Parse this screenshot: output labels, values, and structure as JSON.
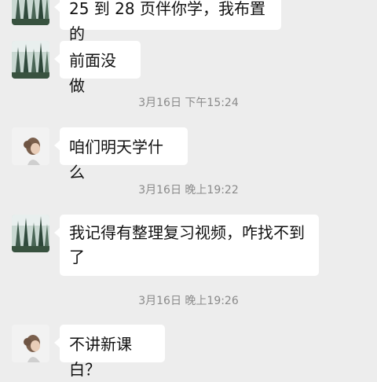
{
  "messages": [
    {
      "kind": "message",
      "avatar": "forest-avatar",
      "text": "25 到 28 页伴你学，我布置的"
    },
    {
      "kind": "message",
      "avatar": "forest-avatar",
      "text": "前面没做"
    },
    {
      "kind": "timestamp",
      "text": "3月16日 下午15:24"
    },
    {
      "kind": "message",
      "avatar": "girl-avatar",
      "text": "咱们明天学什么"
    },
    {
      "kind": "timestamp",
      "text": "3月16日 晚上19:22"
    },
    {
      "kind": "message",
      "avatar": "forest-avatar",
      "text": "我记得有整理复习视频，咋找不到了"
    },
    {
      "kind": "timestamp",
      "text": "3月16日 晚上19:26"
    },
    {
      "kind": "message",
      "avatar": "girl-avatar",
      "text": "不讲新课白？"
    }
  ],
  "colors": {
    "background": "#ededed",
    "bubble": "#ffffff",
    "timestamp": "#8a8a8a"
  }
}
